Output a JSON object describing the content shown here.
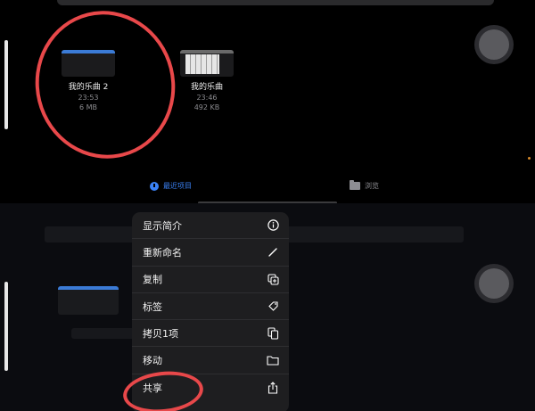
{
  "files": [
    {
      "name": "我的乐曲 2",
      "time": "23:53",
      "size": "6 MB",
      "thumb": "blank"
    },
    {
      "name": "我的乐曲",
      "time": "23:46",
      "size": "492 KB",
      "thumb": "keyboard"
    }
  ],
  "tabs": {
    "recent": "最近项目",
    "browse": "浏览"
  },
  "menu": [
    {
      "label": "显示简介",
      "icon": "info-icon"
    },
    {
      "label": "重新命名",
      "icon": "pencil-icon"
    },
    {
      "label": "复制",
      "icon": "duplicate-icon"
    },
    {
      "label": "标签",
      "icon": "tag-icon"
    },
    {
      "label": "拷贝1项",
      "icon": "copy-icon"
    },
    {
      "label": "移动",
      "icon": "folder-icon"
    },
    {
      "label": "共享",
      "icon": "share-icon"
    }
  ],
  "colors": {
    "accent": "#3b82f6",
    "annotation": "#e8484a"
  }
}
